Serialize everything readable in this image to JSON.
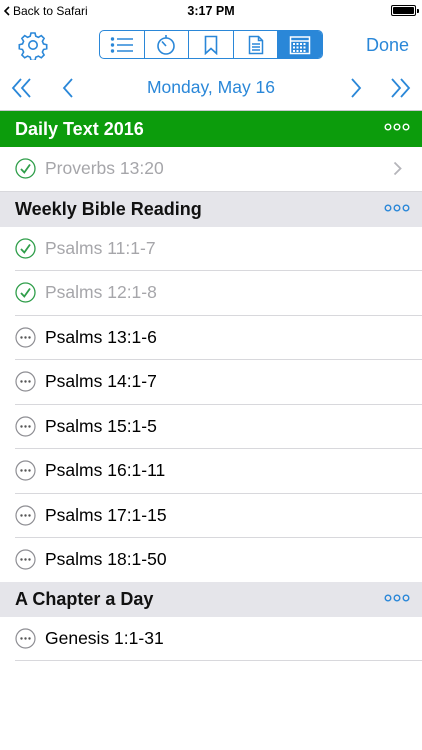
{
  "status": {
    "back": "Back to Safari",
    "time": "3:17 PM"
  },
  "toolbar": {
    "done_label": "Done",
    "segments": [
      "list-icon",
      "timer-icon",
      "bookmark-icon",
      "document-icon",
      "calendar-icon"
    ],
    "active_segment": "calendar-icon"
  },
  "datebar": {
    "date": "Monday, May 16"
  },
  "colors": {
    "accent": "#2a87d8",
    "section_green": "#0c9c0c",
    "checked": "#2f9e4a"
  },
  "sections": [
    {
      "title": "Daily Text 2016",
      "style": "green",
      "items": [
        {
          "label": "Proverbs 13:20",
          "done": true,
          "chevron": true
        }
      ]
    },
    {
      "title": "Weekly Bible Reading",
      "style": "gray",
      "items": [
        {
          "label": "Psalms 11:1-7",
          "done": true
        },
        {
          "label": "Psalms 12:1-8",
          "done": true
        },
        {
          "label": "Psalms 13:1-6",
          "done": false
        },
        {
          "label": "Psalms 14:1-7",
          "done": false
        },
        {
          "label": "Psalms 15:1-5",
          "done": false
        },
        {
          "label": "Psalms 16:1-11",
          "done": false
        },
        {
          "label": "Psalms 17:1-15",
          "done": false
        },
        {
          "label": "Psalms 18:1-50",
          "done": false
        }
      ]
    },
    {
      "title": "A Chapter a Day",
      "style": "gray",
      "items": [
        {
          "label": "Genesis 1:1-31",
          "done": false
        }
      ]
    }
  ]
}
